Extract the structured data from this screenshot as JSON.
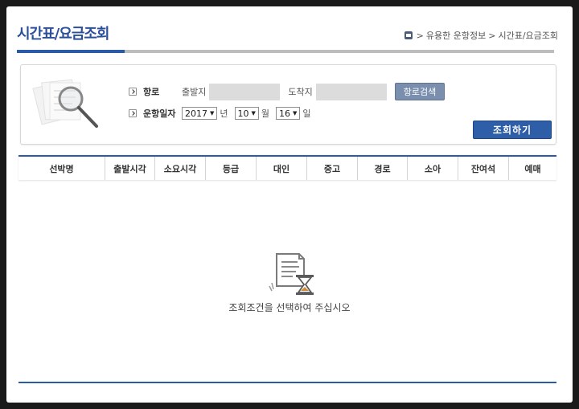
{
  "header": {
    "title": "시간표/요금조회",
    "breadcrumb": [
      "유용한 운항정보",
      "시간표/요금조회"
    ]
  },
  "search": {
    "route_label": "항로",
    "departure_label": "출발지",
    "departure_value": "",
    "arrival_label": "도착지",
    "arrival_value": "",
    "route_search_button": "항로검색",
    "date_label": "운항일자",
    "year": "2017",
    "year_unit": "년",
    "month": "10",
    "month_unit": "월",
    "day": "16",
    "day_unit": "일",
    "query_button": "조회하기"
  },
  "table": {
    "columns": [
      "선박명",
      "출발시각",
      "소요시각",
      "등급",
      "대인",
      "중고",
      "경로",
      "소아",
      "잔여석",
      "예매"
    ]
  },
  "empty_state": {
    "message": "조회조건을 선택하여 주십시오"
  },
  "colors": {
    "accent": "#2b5aa6",
    "title": "#2b4f9a",
    "route_button": "#7a8fae"
  }
}
